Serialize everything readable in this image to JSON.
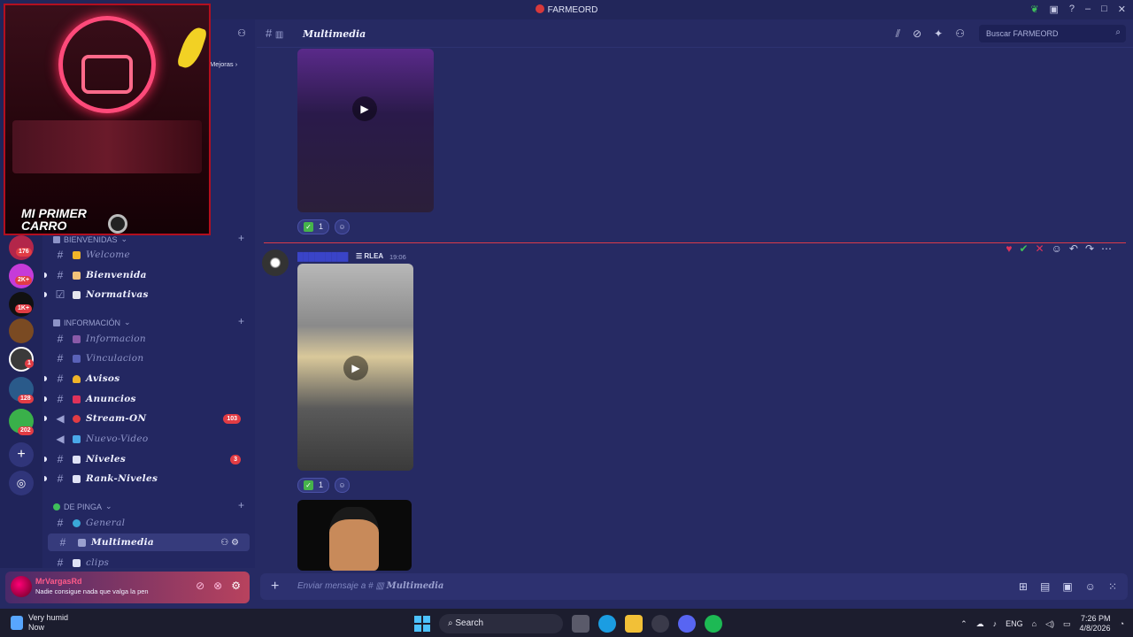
{
  "window": {
    "title": "FARMEORD"
  },
  "rail": {
    "badges": [
      "176",
      "2K+",
      "1K+",
      "1",
      "128",
      "202"
    ]
  },
  "sidebar": {
    "boost_label": "Mejoras",
    "categories": [
      {
        "label": "BIENVENIDAS"
      },
      {
        "label": "INFORMACIÓN"
      },
      {
        "label": "DE PINGA"
      }
    ],
    "channels": [
      {
        "name": "Welcome",
        "bold": false
      },
      {
        "name": "Bienvenida",
        "bold": true
      },
      {
        "name": "Normativas",
        "bold": true
      },
      {
        "name": "Informacion",
        "bold": false
      },
      {
        "name": "Vinculacion",
        "bold": false
      },
      {
        "name": "Avisos",
        "bold": true
      },
      {
        "name": "Anuncios",
        "bold": true
      },
      {
        "name": "Stream-ON",
        "bold": true,
        "badge": "103"
      },
      {
        "name": "Nuevo-Video",
        "bold": false
      },
      {
        "name": "Niveles",
        "bold": true,
        "badge": "3"
      },
      {
        "name": "Rank-Niveles",
        "bold": true
      },
      {
        "name": "General",
        "bold": false
      },
      {
        "name": "Multimedia",
        "bold": true,
        "active": true
      },
      {
        "name": "clips",
        "bold": false
      }
    ]
  },
  "user": {
    "name": "MrVargasRd",
    "status": "Nadie consigue nada que valga la pen"
  },
  "header": {
    "channel": "Multimedia",
    "search_placeholder": "Buscar FARMEORD"
  },
  "messages": {
    "reaction_count_1": "1",
    "reaction_count_2": "1",
    "author_tag": "RLEA",
    "time": "19:06"
  },
  "input": {
    "placeholder": "Enviar mensaje a #",
    "channel": "Multimedia"
  },
  "webcam": {
    "line1": "MI PRIMER",
    "line2": "CARRO"
  },
  "taskbar": {
    "weather_title": "Very humid",
    "weather_sub": "Now",
    "search": "Search",
    "lang": "ENG",
    "time": "7:26 PM",
    "date": "4/8/2026"
  }
}
